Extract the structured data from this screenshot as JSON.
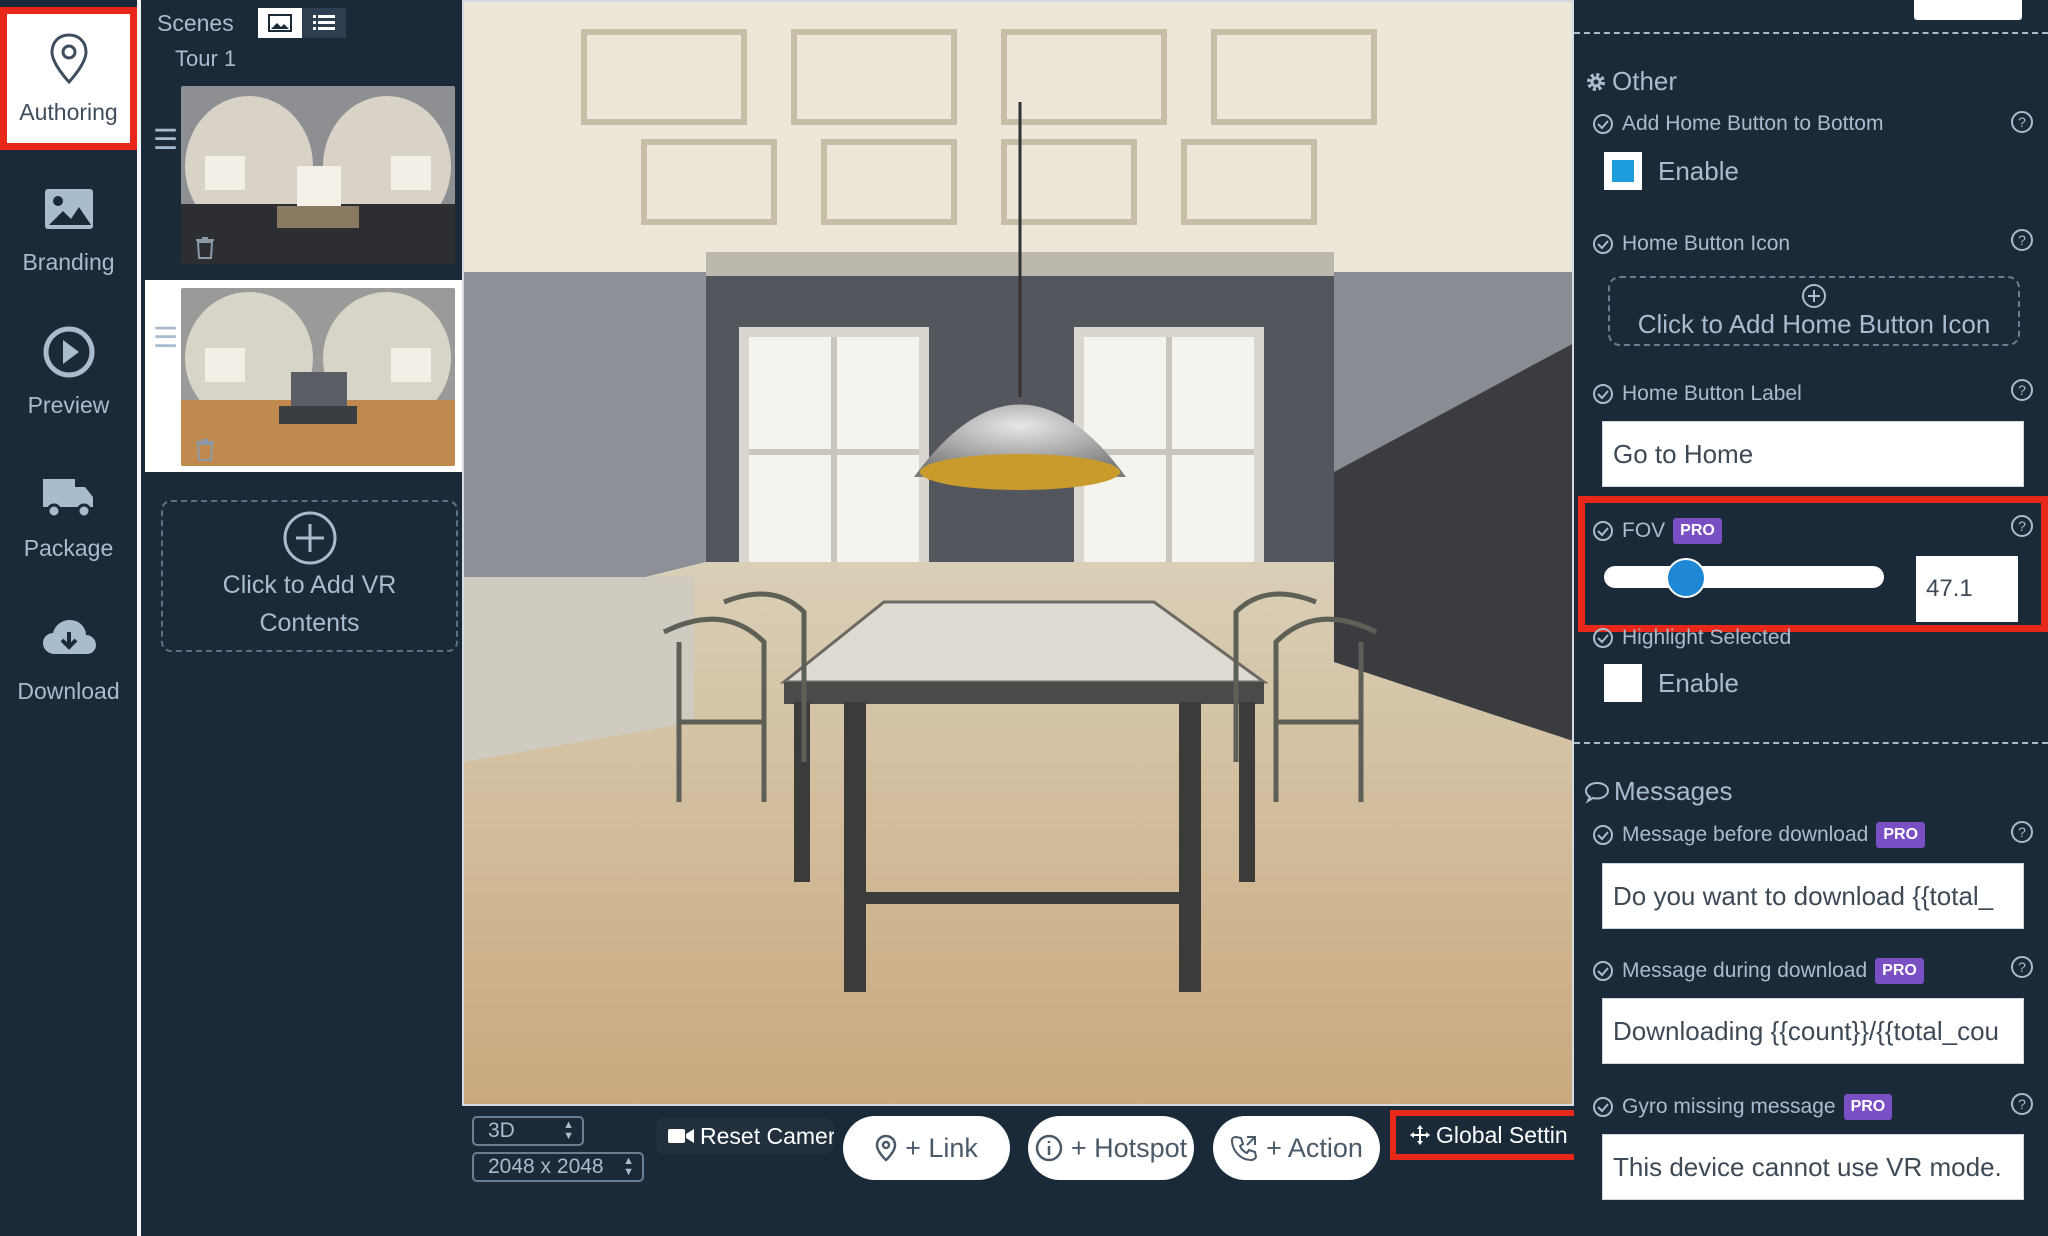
{
  "nav": {
    "items": [
      {
        "label": "Authoring",
        "icon": "map-pin-icon",
        "active": true
      },
      {
        "label": "Branding",
        "icon": "image-icon",
        "active": false
      },
      {
        "label": "Preview",
        "icon": "play-icon",
        "active": false
      },
      {
        "label": "Package",
        "icon": "truck-icon",
        "active": false
      },
      {
        "label": "Download",
        "icon": "cloud-download-icon",
        "active": false
      }
    ]
  },
  "scenes": {
    "header": "Scenes",
    "tour_name": "Tour 1",
    "add_label": "Click to Add VR Contents",
    "scene_count": 2,
    "selected_index": 1
  },
  "toolbar": {
    "mode_select": "3D",
    "resolution_select": "2048 x 2048",
    "reset_camera": "Reset Camer",
    "add_link": "+ Link",
    "add_hotspot": "+ Hotspot",
    "add_action": "+ Action",
    "global_settings": "Global Settin"
  },
  "settings": {
    "other_section": "Other",
    "add_home_button_label": "Add Home Button to Bottom",
    "add_home_button_checkbox": "Enable",
    "add_home_button_checked": true,
    "home_button_icon_label": "Home Button Icon",
    "home_button_icon_add": "Click to Add Home Button Icon",
    "home_button_label_label": "Home Button Label",
    "home_button_label_value": "Go to Home",
    "fov_label": "FOV",
    "fov_value": "47.1",
    "fov_slider_fraction": 0.26,
    "highlight_label": "Highlight Selected",
    "highlight_checkbox": "Enable",
    "highlight_checked": false,
    "messages_section": "Messages",
    "msg_before_label": "Message before download",
    "msg_before_value": "Do you want to download {{total_",
    "msg_during_label": "Message during download",
    "msg_during_value": "Downloading {{count}}/{{total_cou",
    "gyro_label": "Gyro missing message",
    "gyro_value": "This device cannot use VR mode.",
    "pro": "PRO"
  },
  "colors": {
    "background": "#1b2a38",
    "highlight_red": "#e8281a",
    "pro_purple": "#7b4fc4",
    "slider_blue": "#1e88d4"
  }
}
